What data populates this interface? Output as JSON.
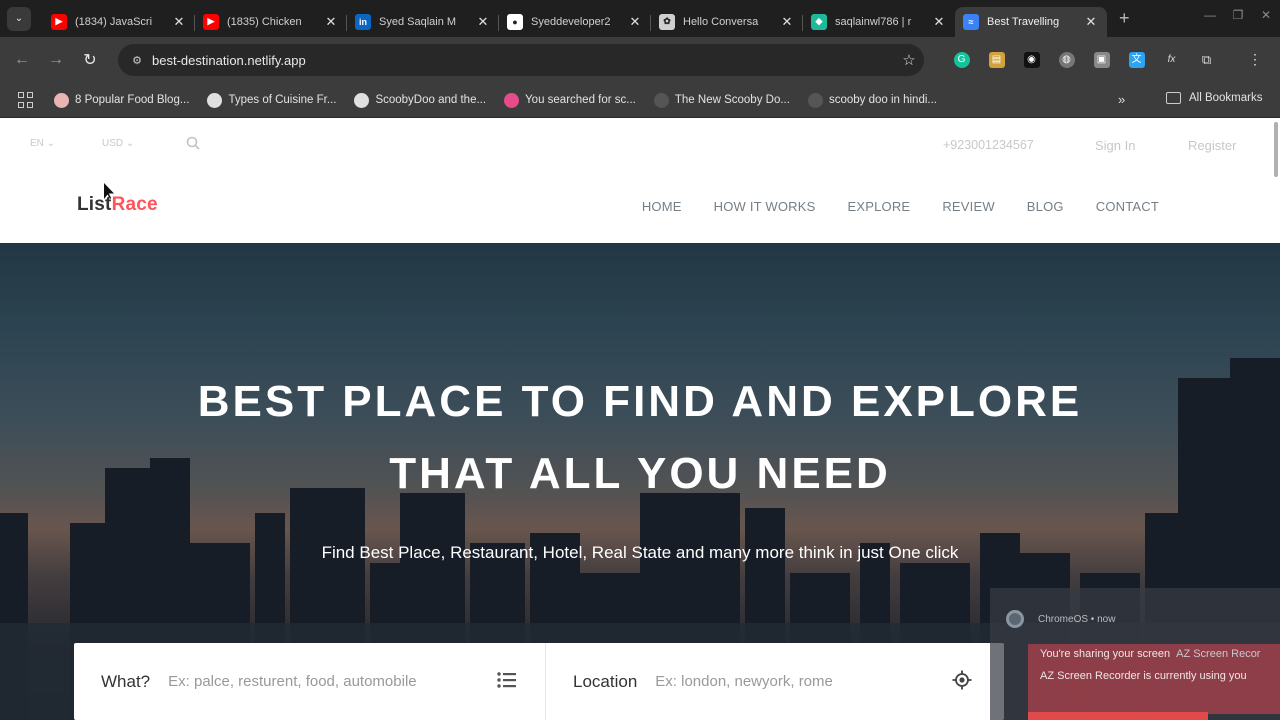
{
  "browser": {
    "tabs": [
      {
        "title": "(1834) JavaScri",
        "favicon_color": "#ff0000",
        "favicon_glyph": "▶"
      },
      {
        "title": "(1835) Chicken",
        "favicon_color": "#ff0000",
        "favicon_glyph": "▶"
      },
      {
        "title": "Syed Saqlain M",
        "favicon_color": "#0a66c2",
        "favicon_glyph": "in"
      },
      {
        "title": "Syeddeveloper2",
        "favicon_color": "#ffffff",
        "favicon_glyph": "●"
      },
      {
        "title": "Hello Conversa",
        "favicon_color": "#cfcfcf",
        "favicon_glyph": "✿"
      },
      {
        "title": "saqlainwl786 | r",
        "favicon_color": "#1fb89a",
        "favicon_glyph": "◆"
      },
      {
        "title": "Best Travelling",
        "favicon_color": "#3b82f6",
        "favicon_glyph": "≈"
      }
    ],
    "active_tab_index": 6,
    "url": "best-destination.netlify.app",
    "bookmarks": [
      {
        "label": "8 Popular Food Blog...",
        "color": "#e8b4b4"
      },
      {
        "label": "Types of Cuisine Fr...",
        "color": "#e0e0e0"
      },
      {
        "label": "ScoobyDoo and the...",
        "color": "#e0e0e0"
      },
      {
        "label": "You searched for sc...",
        "color": "#e84b8a"
      },
      {
        "label": "The New Scooby Do...",
        "color": "#555555"
      },
      {
        "label": "scooby doo in hindi...",
        "color": "#555555"
      }
    ],
    "all_bookmarks_label": "All Bookmarks"
  },
  "site": {
    "topbar": {
      "language": "EN",
      "currency": "USD",
      "phone": "+923001234567",
      "sign_in": "Sign In",
      "register": "Register"
    },
    "logo": {
      "part1": "List",
      "part2": "Race"
    },
    "nav": [
      "HOME",
      "HOW IT WORKS",
      "EXPLORE",
      "REVIEW",
      "BLOG",
      "CONTACT"
    ],
    "hero": {
      "title_line1": "BEST PLACE TO FIND AND EXPLORE",
      "title_line2": "THAT ALL YOU NEED",
      "subtitle": "Find Best Place, Restaurant, Hotel, Real State and many more think in just One click"
    },
    "search": {
      "what_label": "What?",
      "what_placeholder": "Ex: palce, resturent, food, automobile",
      "location_label": "Location",
      "location_placeholder": "Ex: london, newyork, rome"
    }
  },
  "notification": {
    "source": "ChromeOS • now",
    "line1": "You're sharing your screen",
    "line1_app": "AZ Screen Recor",
    "line2": "AZ Screen Recorder is currently using you"
  },
  "colors": {
    "brand_accent": "#ff545a",
    "nav_text": "#767f86"
  }
}
